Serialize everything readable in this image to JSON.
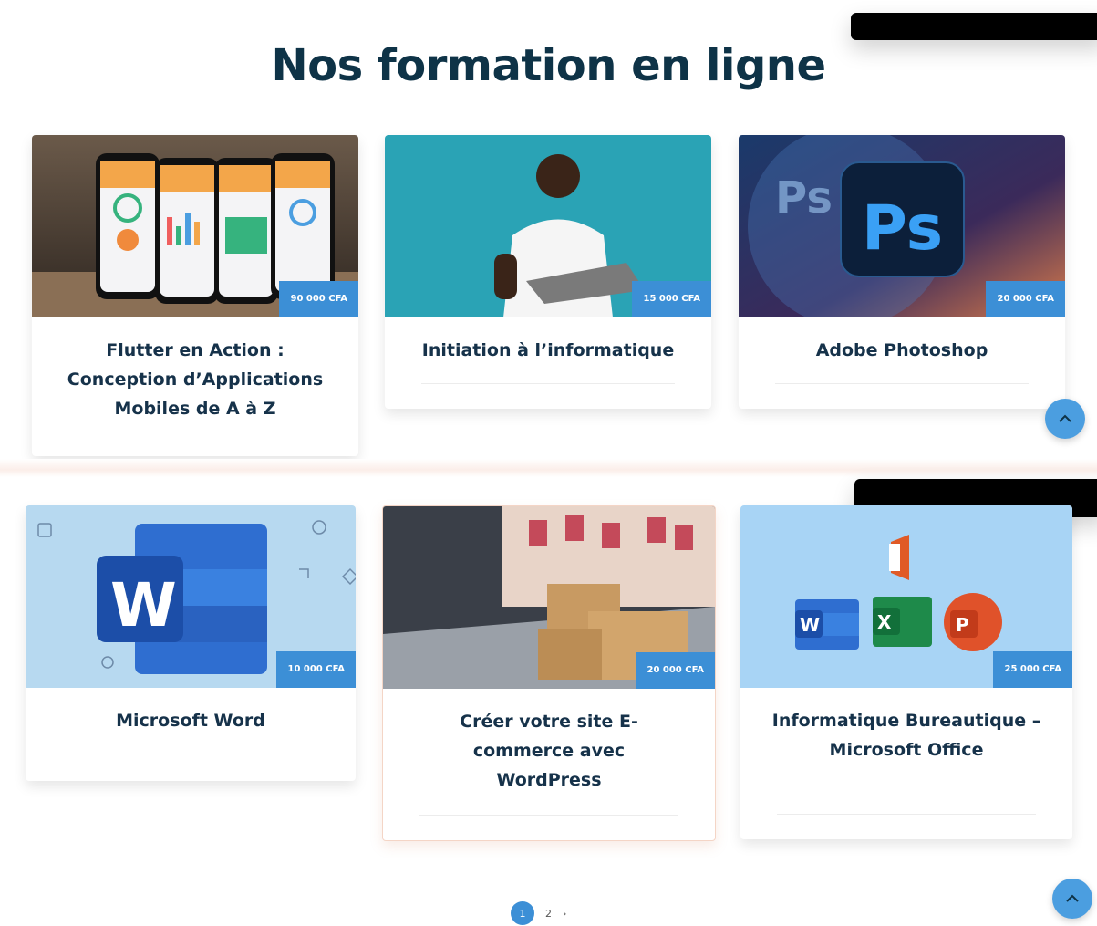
{
  "page": {
    "title": "Nos formation en ligne"
  },
  "courses": [
    {
      "title": "Flutter en Action : Conception d’Applications Mobiles de A à Z",
      "price": "90 000 CFA",
      "image": "flutter-phones-image"
    },
    {
      "title": "Initiation à l’informatique",
      "price": "15 000 CFA",
      "image": "man-with-laptop-image"
    },
    {
      "title": "Adobe Photoshop",
      "price": "20 000 CFA",
      "image": "photoshop-logo-image"
    },
    {
      "title": "Microsoft Word",
      "price": "10 000 CFA",
      "image": "microsoft-word-logo-image"
    },
    {
      "title": "Créer votre site E-commerce avec WordPress",
      "price": "20 000 CFA",
      "image": "ecommerce-boxes-laptop-image"
    },
    {
      "title": "Informatique Bureautique – Microsoft Office",
      "price": "25 000 CFA",
      "image": "microsoft-office-logos-image"
    }
  ],
  "icons": {
    "word_letter": "W",
    "ps_letters": "Ps",
    "ps_bg_letters": "Ps",
    "excel_letter": "X",
    "powerpoint_letter": "P"
  },
  "pagination": {
    "current": "1",
    "next_page": "2",
    "next_arrow": "›"
  },
  "colors": {
    "accent": "#3c8fd6",
    "title": "#0e3347"
  }
}
